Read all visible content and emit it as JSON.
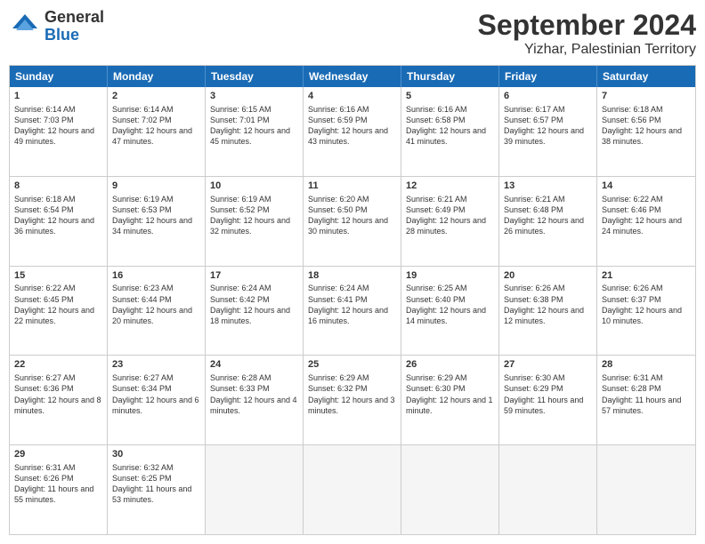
{
  "logo": {
    "general": "General",
    "blue": "Blue"
  },
  "title": {
    "month": "September 2024",
    "location": "Yizhar, Palestinian Territory"
  },
  "header_days": [
    "Sunday",
    "Monday",
    "Tuesday",
    "Wednesday",
    "Thursday",
    "Friday",
    "Saturday"
  ],
  "weeks": [
    [
      {
        "day": "1",
        "sunrise": "Sunrise: 6:14 AM",
        "sunset": "Sunset: 7:03 PM",
        "daylight": "Daylight: 12 hours and 49 minutes."
      },
      {
        "day": "2",
        "sunrise": "Sunrise: 6:14 AM",
        "sunset": "Sunset: 7:02 PM",
        "daylight": "Daylight: 12 hours and 47 minutes."
      },
      {
        "day": "3",
        "sunrise": "Sunrise: 6:15 AM",
        "sunset": "Sunset: 7:01 PM",
        "daylight": "Daylight: 12 hours and 45 minutes."
      },
      {
        "day": "4",
        "sunrise": "Sunrise: 6:16 AM",
        "sunset": "Sunset: 6:59 PM",
        "daylight": "Daylight: 12 hours and 43 minutes."
      },
      {
        "day": "5",
        "sunrise": "Sunrise: 6:16 AM",
        "sunset": "Sunset: 6:58 PM",
        "daylight": "Daylight: 12 hours and 41 minutes."
      },
      {
        "day": "6",
        "sunrise": "Sunrise: 6:17 AM",
        "sunset": "Sunset: 6:57 PM",
        "daylight": "Daylight: 12 hours and 39 minutes."
      },
      {
        "day": "7",
        "sunrise": "Sunrise: 6:18 AM",
        "sunset": "Sunset: 6:56 PM",
        "daylight": "Daylight: 12 hours and 38 minutes."
      }
    ],
    [
      {
        "day": "8",
        "sunrise": "Sunrise: 6:18 AM",
        "sunset": "Sunset: 6:54 PM",
        "daylight": "Daylight: 12 hours and 36 minutes."
      },
      {
        "day": "9",
        "sunrise": "Sunrise: 6:19 AM",
        "sunset": "Sunset: 6:53 PM",
        "daylight": "Daylight: 12 hours and 34 minutes."
      },
      {
        "day": "10",
        "sunrise": "Sunrise: 6:19 AM",
        "sunset": "Sunset: 6:52 PM",
        "daylight": "Daylight: 12 hours and 32 minutes."
      },
      {
        "day": "11",
        "sunrise": "Sunrise: 6:20 AM",
        "sunset": "Sunset: 6:50 PM",
        "daylight": "Daylight: 12 hours and 30 minutes."
      },
      {
        "day": "12",
        "sunrise": "Sunrise: 6:21 AM",
        "sunset": "Sunset: 6:49 PM",
        "daylight": "Daylight: 12 hours and 28 minutes."
      },
      {
        "day": "13",
        "sunrise": "Sunrise: 6:21 AM",
        "sunset": "Sunset: 6:48 PM",
        "daylight": "Daylight: 12 hours and 26 minutes."
      },
      {
        "day": "14",
        "sunrise": "Sunrise: 6:22 AM",
        "sunset": "Sunset: 6:46 PM",
        "daylight": "Daylight: 12 hours and 24 minutes."
      }
    ],
    [
      {
        "day": "15",
        "sunrise": "Sunrise: 6:22 AM",
        "sunset": "Sunset: 6:45 PM",
        "daylight": "Daylight: 12 hours and 22 minutes."
      },
      {
        "day": "16",
        "sunrise": "Sunrise: 6:23 AM",
        "sunset": "Sunset: 6:44 PM",
        "daylight": "Daylight: 12 hours and 20 minutes."
      },
      {
        "day": "17",
        "sunrise": "Sunrise: 6:24 AM",
        "sunset": "Sunset: 6:42 PM",
        "daylight": "Daylight: 12 hours and 18 minutes."
      },
      {
        "day": "18",
        "sunrise": "Sunrise: 6:24 AM",
        "sunset": "Sunset: 6:41 PM",
        "daylight": "Daylight: 12 hours and 16 minutes."
      },
      {
        "day": "19",
        "sunrise": "Sunrise: 6:25 AM",
        "sunset": "Sunset: 6:40 PM",
        "daylight": "Daylight: 12 hours and 14 minutes."
      },
      {
        "day": "20",
        "sunrise": "Sunrise: 6:26 AM",
        "sunset": "Sunset: 6:38 PM",
        "daylight": "Daylight: 12 hours and 12 minutes."
      },
      {
        "day": "21",
        "sunrise": "Sunrise: 6:26 AM",
        "sunset": "Sunset: 6:37 PM",
        "daylight": "Daylight: 12 hours and 10 minutes."
      }
    ],
    [
      {
        "day": "22",
        "sunrise": "Sunrise: 6:27 AM",
        "sunset": "Sunset: 6:36 PM",
        "daylight": "Daylight: 12 hours and 8 minutes."
      },
      {
        "day": "23",
        "sunrise": "Sunrise: 6:27 AM",
        "sunset": "Sunset: 6:34 PM",
        "daylight": "Daylight: 12 hours and 6 minutes."
      },
      {
        "day": "24",
        "sunrise": "Sunrise: 6:28 AM",
        "sunset": "Sunset: 6:33 PM",
        "daylight": "Daylight: 12 hours and 4 minutes."
      },
      {
        "day": "25",
        "sunrise": "Sunrise: 6:29 AM",
        "sunset": "Sunset: 6:32 PM",
        "daylight": "Daylight: 12 hours and 3 minutes."
      },
      {
        "day": "26",
        "sunrise": "Sunrise: 6:29 AM",
        "sunset": "Sunset: 6:30 PM",
        "daylight": "Daylight: 12 hours and 1 minute."
      },
      {
        "day": "27",
        "sunrise": "Sunrise: 6:30 AM",
        "sunset": "Sunset: 6:29 PM",
        "daylight": "Daylight: 11 hours and 59 minutes."
      },
      {
        "day": "28",
        "sunrise": "Sunrise: 6:31 AM",
        "sunset": "Sunset: 6:28 PM",
        "daylight": "Daylight: 11 hours and 57 minutes."
      }
    ],
    [
      {
        "day": "29",
        "sunrise": "Sunrise: 6:31 AM",
        "sunset": "Sunset: 6:26 PM",
        "daylight": "Daylight: 11 hours and 55 minutes."
      },
      {
        "day": "30",
        "sunrise": "Sunrise: 6:32 AM",
        "sunset": "Sunset: 6:25 PM",
        "daylight": "Daylight: 11 hours and 53 minutes."
      },
      {
        "day": "",
        "sunrise": "",
        "sunset": "",
        "daylight": ""
      },
      {
        "day": "",
        "sunrise": "",
        "sunset": "",
        "daylight": ""
      },
      {
        "day": "",
        "sunrise": "",
        "sunset": "",
        "daylight": ""
      },
      {
        "day": "",
        "sunrise": "",
        "sunset": "",
        "daylight": ""
      },
      {
        "day": "",
        "sunrise": "",
        "sunset": "",
        "daylight": ""
      }
    ]
  ]
}
